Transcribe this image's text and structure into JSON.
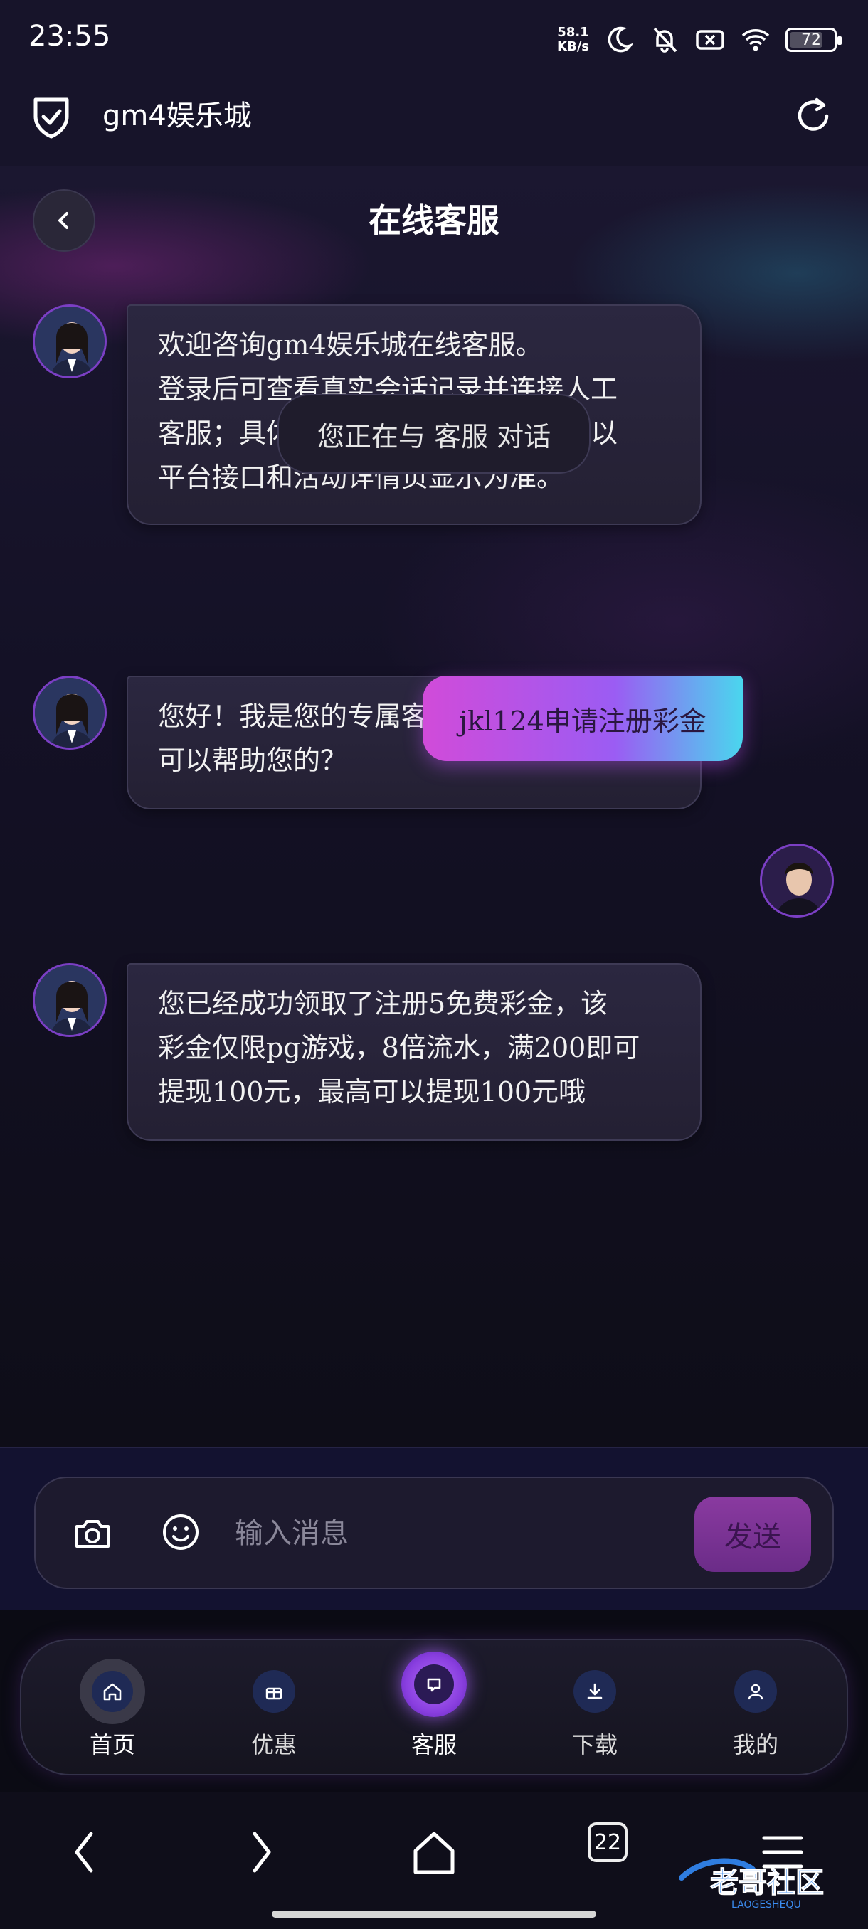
{
  "status_bar": {
    "time": "23:55",
    "net_speed_top": "58.1",
    "net_speed_bottom": "KB/s",
    "battery": "72",
    "icons": [
      "moon-icon",
      "bell-off-icon",
      "sim-x-icon",
      "wifi-icon",
      "battery-icon"
    ]
  },
  "browser": {
    "site_title": "gm4娱乐城"
  },
  "page": {
    "title": "在线客服"
  },
  "messages": [
    {
      "from": "agent",
      "lines": [
        "欢迎咨询gm4娱乐城在线客服。",
        "登录后可查看真实会话记录并连接人工",
        "客服；具体活动、奖励与账户信息请以",
        "平台接口和活动详情页显示为准。"
      ]
    },
    {
      "from": "system",
      "text": "您正在与 客服 对话"
    },
    {
      "from": "agent",
      "lines": [
        "您好！我是您的专属客服，请问有什么",
        "可以帮助您的？"
      ]
    },
    {
      "from": "user",
      "text": "jkl124申请注册彩金"
    },
    {
      "from": "agent",
      "lines": [
        "您已经成功领取了注册5免费彩金，该",
        "彩金仅限pg游戏，8倍流水，满200即可",
        "提现100元，最高可以提现100元哦"
      ]
    }
  ],
  "composer": {
    "placeholder": "输入消息",
    "send_label": "发送"
  },
  "tabs": [
    {
      "label": "首页",
      "icon": "home-icon"
    },
    {
      "label": "优惠",
      "icon": "gift-icon"
    },
    {
      "label": "客服",
      "icon": "chat-icon",
      "active": true
    },
    {
      "label": "下载",
      "icon": "download-icon"
    },
    {
      "label": "我的",
      "icon": "user-icon"
    }
  ],
  "system_nav": {
    "tab_count": "22"
  },
  "watermark": {
    "text": "老哥社区",
    "subtext": "LAOGESHEQU"
  },
  "colors": {
    "accent_purple": "#9b5cf3",
    "accent_pink": "#d14bd9",
    "accent_cyan": "#4ad6ee",
    "background": "#0f0d1c"
  }
}
